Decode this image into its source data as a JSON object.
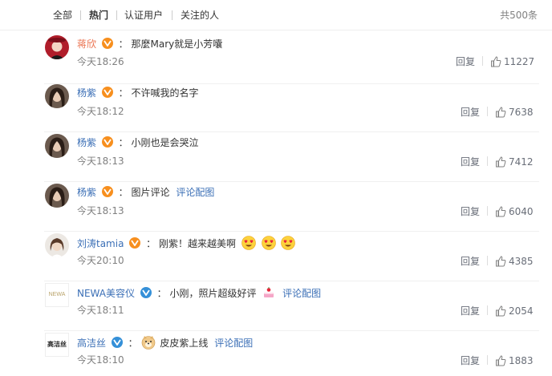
{
  "filters": {
    "all": "全部",
    "hot": "热门",
    "verified": "认证用户",
    "following": "关注的人",
    "total": "共500条"
  },
  "comments": [
    {
      "user": "蒋欣",
      "text": "那麼Mary就是小芳囔",
      "link": "",
      "time": "今天18:26",
      "reply": "回复",
      "likes": "11227"
    },
    {
      "user": "杨紫",
      "text": "不许喊我的名字",
      "link": "",
      "time": "今天18:12",
      "reply": "回复",
      "likes": "7638"
    },
    {
      "user": "杨紫",
      "text": "小刚也是会哭泣",
      "link": "",
      "time": "今天18:13",
      "reply": "回复",
      "likes": "7412"
    },
    {
      "user": "杨紫",
      "text": "图片评论",
      "link": "评论配图",
      "time": "今天18:13",
      "reply": "回复",
      "likes": "6040"
    },
    {
      "user": "刘涛tamia",
      "text": "刚紫！越来越美啊",
      "link": "",
      "time": "今天20:10",
      "reply": "回复",
      "likes": "4385"
    },
    {
      "user": "NEWA美容仪",
      "avatar_text": "NEWA",
      "text": "小刚，照片超级好评",
      "link": "评论配图",
      "time": "今天18:11",
      "reply": "回复",
      "likes": "2054"
    },
    {
      "user": "高洁丝",
      "avatar_text": "高洁丝",
      "text": "皮皮紫上线",
      "link": "评论配图",
      "time": "今天18:10",
      "reply": "回复",
      "likes": "1883"
    }
  ],
  "icons": {
    "verified_badge": "v-badge-icon",
    "like": "thumbs-up-icon",
    "heart_eyes": "heart-eyes-emoji",
    "cake": "cake-emoji",
    "doge": "doge-emoji"
  },
  "colors": {
    "username_orange": "#eb7350",
    "link_blue": "#3b6fb6",
    "badge_orange": "#f78f1e",
    "badge_blue": "#3590d8",
    "muted": "#808080"
  }
}
